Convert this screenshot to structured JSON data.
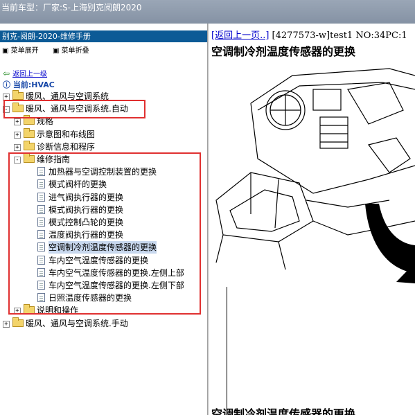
{
  "window": {
    "title": "当前车型：厂家:S-上海别克阅朗2020"
  },
  "left_panel": {
    "header": "别克-阅朗-2020-维修手册",
    "menu": {
      "expand": "菜单展开",
      "collapse": "菜单折叠"
    },
    "back_link": "返回上一级",
    "current": "当前:HVAC",
    "tree": [
      {
        "label": "暖风、通风与空调系统",
        "level": 0,
        "type": "folder",
        "toggle": "+"
      },
      {
        "label": "暖风、通风与空调系统.自动",
        "level": 0,
        "type": "folder-open",
        "toggle": "-"
      },
      {
        "label": "规格",
        "level": 1,
        "type": "folder",
        "toggle": "+"
      },
      {
        "label": "示意图和布线图",
        "level": 1,
        "type": "folder",
        "toggle": "+"
      },
      {
        "label": "诊断信息和程序",
        "level": 1,
        "type": "folder",
        "toggle": "+"
      },
      {
        "label": "维修指南",
        "level": 1,
        "type": "folder-open",
        "toggle": "-"
      },
      {
        "label": "加热器与空调控制装置的更换",
        "level": 2,
        "type": "doc"
      },
      {
        "label": "模式阀杆的更换",
        "level": 2,
        "type": "doc"
      },
      {
        "label": "进气阀执行器的更换",
        "level": 2,
        "type": "doc"
      },
      {
        "label": "模式阀执行器的更换",
        "level": 2,
        "type": "doc"
      },
      {
        "label": "模式控制凸轮的更换",
        "level": 2,
        "type": "doc"
      },
      {
        "label": "温度阀执行器的更换",
        "level": 2,
        "type": "doc"
      },
      {
        "label": "空调制冷剂温度传感器的更换",
        "level": 2,
        "type": "doc",
        "selected": true
      },
      {
        "label": "车内空气温度传感器的更换",
        "level": 2,
        "type": "doc"
      },
      {
        "label": "车内空气温度传感器的更换.左侧上部",
        "level": 2,
        "type": "doc"
      },
      {
        "label": "车内空气温度传感器的更换.左侧下部",
        "level": 2,
        "type": "doc"
      },
      {
        "label": "日照温度传感器的更换",
        "level": 2,
        "type": "doc"
      },
      {
        "label": "说明和操作",
        "level": 1,
        "type": "folder",
        "toggle": "+"
      },
      {
        "label": "暖风、通风与空调系统.手动",
        "level": 0,
        "type": "folder",
        "toggle": "+"
      }
    ]
  },
  "content": {
    "back_link": "[返回上一页..]",
    "meta": " [4277573-w]test1 NO:34PC:1",
    "title": "空调制冷剂温度传感器的更换",
    "footer_title": "空调制冷剂温度传感器的更换"
  },
  "colors": {
    "accent_red": "#e03030",
    "header_blue": "#0c5a96",
    "selection": "#c8d8ee"
  }
}
